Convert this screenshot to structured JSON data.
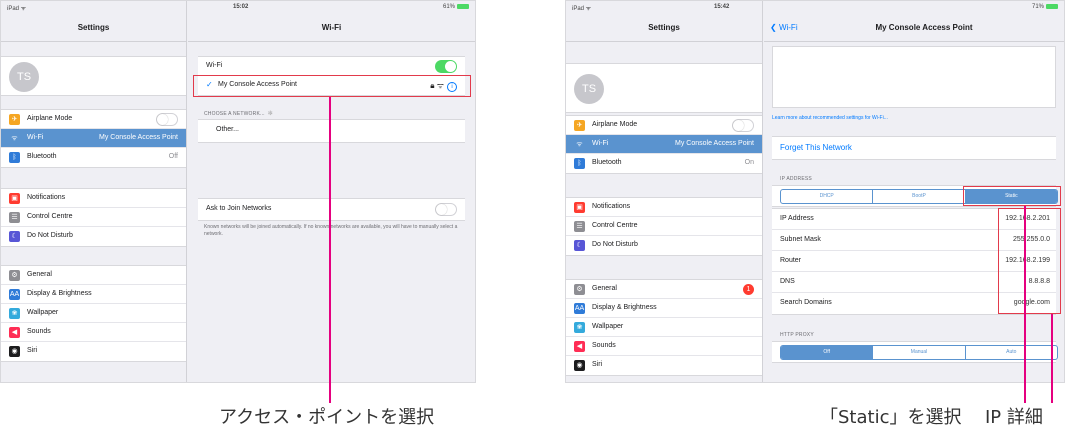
{
  "left_screen": {
    "status": {
      "carrier": "iPad ᯤ",
      "time": "15:02",
      "battery": "61%"
    },
    "sidebar_title": "Settings",
    "avatar": "TS",
    "groups": [
      [
        {
          "label": "Airplane Mode",
          "icon": "airplane-icon",
          "color": "#f5a623",
          "glyph": "✈",
          "toggle": "off"
        },
        {
          "label": "Wi-Fi",
          "value": "My Console Access Point",
          "icon": "wifi-icon",
          "color": "#5a93cf",
          "glyph": "ᯤ",
          "active": true
        },
        {
          "label": "Bluetooth",
          "value": "Off",
          "icon": "bluetooth-icon",
          "color": "#2f7bd8",
          "glyph": "ᛒ"
        }
      ],
      [
        {
          "label": "Notifications",
          "icon": "notifications-icon",
          "color": "#ff3b30",
          "glyph": "▣"
        },
        {
          "label": "Control Centre",
          "icon": "control-centre-icon",
          "color": "#8e8e93",
          "glyph": "☰"
        },
        {
          "label": "Do Not Disturb",
          "icon": "moon-icon",
          "color": "#5856d6",
          "glyph": "☾"
        }
      ],
      [
        {
          "label": "General",
          "icon": "gear-icon",
          "color": "#8e8e93",
          "glyph": "⚙"
        },
        {
          "label": "Display & Brightness",
          "icon": "display-icon",
          "color": "#2f7bd8",
          "glyph": "AA"
        },
        {
          "label": "Wallpaper",
          "icon": "wallpaper-icon",
          "color": "#34aadc",
          "glyph": "❀"
        },
        {
          "label": "Sounds",
          "icon": "sounds-icon",
          "color": "#ff2d55",
          "glyph": "◀"
        },
        {
          "label": "Siri",
          "icon": "siri-icon",
          "color": "#1c1c1e",
          "glyph": "◉"
        }
      ]
    ],
    "detail": {
      "title": "Wi-Fi",
      "wifi_label": "Wi-Fi",
      "wifi_toggle": "on",
      "connected_network": "My Console Access Point",
      "choose_header": "CHOOSE A NETWORK...",
      "other_label": "Other...",
      "ask_label": "Ask to Join Networks",
      "ask_toggle": "off",
      "ask_footnote": "Known networks will be joined automatically. If no known networks are available, you will have to manually select a network."
    },
    "caption": "アクセス・ポイントを選択"
  },
  "right_screen": {
    "status": {
      "carrier": "iPad ᯤ",
      "time": "15:42",
      "battery": "71%"
    },
    "sidebar_title": "Settings",
    "avatar": "TS",
    "groups": [
      [
        {
          "label": "Airplane Mode",
          "icon": "airplane-icon",
          "color": "#f5a623",
          "glyph": "✈",
          "toggle": "off"
        },
        {
          "label": "Wi-Fi",
          "value": "My Console Access Point",
          "icon": "wifi-icon",
          "color": "#5a93cf",
          "glyph": "ᯤ",
          "active": true
        },
        {
          "label": "Bluetooth",
          "value": "On",
          "icon": "bluetooth-icon",
          "color": "#2f7bd8",
          "glyph": "ᛒ"
        }
      ],
      [
        {
          "label": "Notifications",
          "icon": "notifications-icon",
          "color": "#ff3b30",
          "glyph": "▣"
        },
        {
          "label": "Control Centre",
          "icon": "control-centre-icon",
          "color": "#8e8e93",
          "glyph": "☰"
        },
        {
          "label": "Do Not Disturb",
          "icon": "moon-icon",
          "color": "#5856d6",
          "glyph": "☾"
        }
      ],
      [
        {
          "label": "General",
          "icon": "gear-icon",
          "color": "#8e8e93",
          "glyph": "⚙",
          "badge": "1"
        },
        {
          "label": "Display & Brightness",
          "icon": "display-icon",
          "color": "#2f7bd8",
          "glyph": "AA"
        },
        {
          "label": "Wallpaper",
          "icon": "wallpaper-icon",
          "color": "#34aadc",
          "glyph": "❀"
        },
        {
          "label": "Sounds",
          "icon": "sounds-icon",
          "color": "#ff2d55",
          "glyph": "◀"
        },
        {
          "label": "Siri",
          "icon": "siri-icon",
          "color": "#1c1c1e",
          "glyph": "◉"
        }
      ]
    ],
    "detail": {
      "back_label": "Wi-Fi",
      "title": "My Console Access Point",
      "learn_more": "Learn more about recommended settings for Wi-Fi...",
      "forget_label": "Forget This Network",
      "ip_header": "IP ADDRESS",
      "ip_modes": [
        "DHCP",
        "BootP",
        "Static"
      ],
      "ip_mode_selected": "Static",
      "fields": [
        {
          "label": "IP Address",
          "value": "192.168.2.201"
        },
        {
          "label": "Subnet Mask",
          "value": "255.255.0.0"
        },
        {
          "label": "Router",
          "value": "192.168.2.199"
        },
        {
          "label": "DNS",
          "value": "8.8.8.8"
        },
        {
          "label": "Search Domains",
          "value": "google.com"
        }
      ],
      "proxy_header": "HTTP PROXY",
      "proxy_modes": [
        "Off",
        "Manual",
        "Auto"
      ],
      "proxy_selected": "Off"
    },
    "caption_static": "「Static」を選択",
    "caption_ip": "IP 詳細"
  },
  "colors": {
    "highlight": "#e23a4b",
    "pointer": "#e5007f",
    "accent": "#5a93cf",
    "toggle_on": "#4cd964"
  }
}
